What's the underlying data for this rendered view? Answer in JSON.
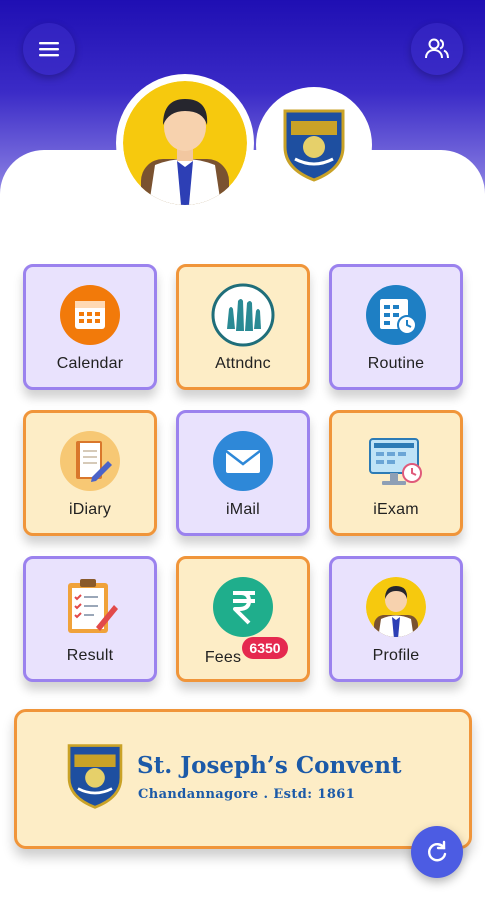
{
  "colors": {
    "header": "#2b1bbd",
    "tile_purple": "#e9e2fd",
    "tile_orange": "#fdedc6",
    "accent": "#4c5ce3",
    "badge": "#e5294f"
  },
  "header": {
    "menu_icon": "hamburger-menu-icon",
    "users_icon": "users-icon"
  },
  "tiles": [
    {
      "label": "Calendar",
      "icon": "calendar-icon"
    },
    {
      "label": "Attndnc",
      "icon": "raised-hands-icon"
    },
    {
      "label": "Routine",
      "icon": "routine-schedule-icon"
    },
    {
      "label": "iDiary",
      "icon": "diary-icon"
    },
    {
      "label": "iMail",
      "icon": "mail-icon"
    },
    {
      "label": "iExam",
      "icon": "exam-computer-icon"
    },
    {
      "label": "Result",
      "icon": "clipboard-result-icon"
    },
    {
      "label": "Fees",
      "icon": "rupee-icon",
      "badge": "6350"
    },
    {
      "label": "Profile",
      "icon": "student-profile-icon"
    }
  ],
  "banner": {
    "school_name": "St. Joseph’s Convent",
    "subtitle": "Chandannagore . Estd: 1861"
  },
  "fab": {
    "icon": "refresh-icon"
  }
}
